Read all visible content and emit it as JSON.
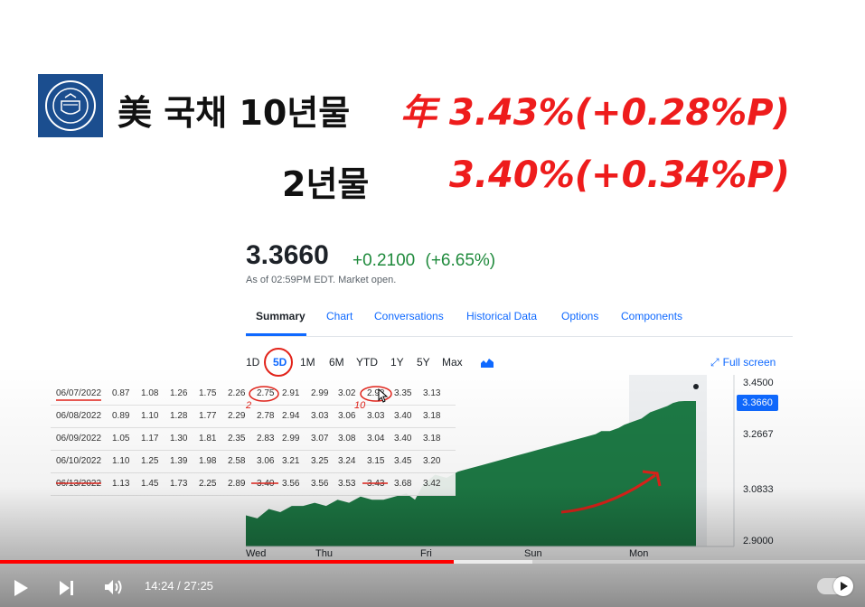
{
  "title": {
    "line1_left": "美 국채 10년물",
    "line1_right": "年 3.43%(+0.28%P)",
    "line2_left": "2년물",
    "line2_right": "3.40%(+0.34%P)"
  },
  "quote": {
    "price": "3.3660",
    "change": "+0.2100",
    "change_pct": "(+6.65%)",
    "as_of": "As of 02:59PM EDT. Market open."
  },
  "tabs": [
    "Summary",
    "Chart",
    "Conversations",
    "Historical Data",
    "Options",
    "Components"
  ],
  "ranges": [
    "1D",
    "5D",
    "1M",
    "6M",
    "YTD",
    "1Y",
    "5Y",
    "Max"
  ],
  "active_range": "5D",
  "fullscreen_label": "Full screen",
  "yield_table": {
    "rows": [
      {
        "date": "06/07/2022",
        "values": [
          "0.87",
          "1.08",
          "1.26",
          "1.75",
          "2.26",
          "2.75",
          "2.91",
          "2.99",
          "3.02",
          "2.98",
          "3.35",
          "3.13"
        ]
      },
      {
        "date": "06/08/2022",
        "values": [
          "0.89",
          "1.10",
          "1.28",
          "1.77",
          "2.29",
          "2.78",
          "2.94",
          "3.03",
          "3.06",
          "3.03",
          "3.40",
          "3.18"
        ]
      },
      {
        "date": "06/09/2022",
        "values": [
          "1.05",
          "1.17",
          "1.30",
          "1.81",
          "2.35",
          "2.83",
          "2.99",
          "3.07",
          "3.08",
          "3.04",
          "3.40",
          "3.18"
        ]
      },
      {
        "date": "06/10/2022",
        "values": [
          "1.10",
          "1.25",
          "1.39",
          "1.98",
          "2.58",
          "3.06",
          "3.21",
          "3.25",
          "3.24",
          "3.15",
          "3.45",
          "3.20"
        ]
      },
      {
        "date": "06/13/2022",
        "values": [
          "1.13",
          "1.45",
          "1.73",
          "2.25",
          "2.89",
          "3.40",
          "3.56",
          "3.56",
          "3.53",
          "3.43",
          "3.68",
          "3.42"
        ]
      }
    ],
    "annotations": [
      "2",
      "10"
    ]
  },
  "chart_data": {
    "type": "area",
    "x_labels": [
      "Wed",
      "Thu",
      "Fri",
      "Sun",
      "Mon"
    ],
    "y_ticks": [
      3.45,
      3.2667,
      3.0833,
      2.9
    ],
    "y_tick_labels": [
      "3.4500",
      "3.2667",
      "3.0833",
      "2.9000"
    ],
    "ylim": [
      2.9,
      3.45
    ],
    "current_label": "3.3660",
    "color": "#1d7a45",
    "series": [
      {
        "x": [
          0,
          0.2,
          0.4,
          0.6,
          0.8,
          1.0,
          1.2,
          1.4,
          1.6,
          1.8,
          2.0,
          2.2,
          2.4,
          2.6,
          2.8,
          2.95,
          3.1,
          3.3,
          3.5,
          3.7,
          3.9,
          4.1,
          4.3,
          4.5,
          4.7,
          4.9,
          5.1,
          5.3,
          5.5,
          5.7,
          5.9,
          6.1,
          6.2,
          6.35,
          6.5,
          6.6,
          6.75,
          6.9,
          7.05,
          7.2,
          7.35,
          7.45,
          7.55,
          7.65,
          7.75,
          7.85
        ],
        "y": [
          3.0,
          2.99,
          3.02,
          3.01,
          3.03,
          3.03,
          3.04,
          3.03,
          3.05,
          3.04,
          3.06,
          3.05,
          3.05,
          3.06,
          3.07,
          3.05,
          3.1,
          3.13,
          3.12,
          3.14,
          3.15,
          3.16,
          3.17,
          3.18,
          3.19,
          3.2,
          3.21,
          3.22,
          3.23,
          3.24,
          3.25,
          3.26,
          3.27,
          3.27,
          3.28,
          3.29,
          3.3,
          3.31,
          3.33,
          3.34,
          3.35,
          3.36,
          3.365,
          3.366,
          3.366,
          3.366
        ]
      }
    ]
  },
  "player": {
    "time": "14:24 / 27:25",
    "progress": 0.525,
    "buffered": 0.545
  },
  "colors": {
    "red_text": "#ee1c1c",
    "up_green": "#1f8a3c",
    "link_blue": "#0f69ff",
    "progress_red": "#ff0000"
  },
  "icons": [
    "treasury-seal-icon",
    "fullscreen-icon",
    "mountain-chart-icon",
    "play-icon",
    "next-icon",
    "volume-icon",
    "autoplay-toggle"
  ]
}
